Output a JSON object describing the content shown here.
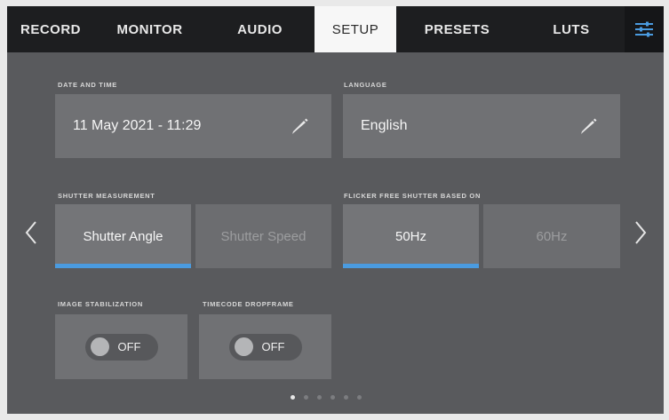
{
  "tabs": [
    {
      "label": "RECORD",
      "active": false
    },
    {
      "label": "MONITOR",
      "active": false
    },
    {
      "label": "AUDIO",
      "active": false
    },
    {
      "label": "SETUP",
      "active": true
    },
    {
      "label": "PRESETS",
      "active": false
    },
    {
      "label": "LUTS",
      "active": false
    }
  ],
  "settings_icon": "sliders-icon",
  "date_time": {
    "label": "DATE AND TIME",
    "value": "11 May 2021 - 11:29",
    "icon": "pencil-icon"
  },
  "language": {
    "label": "LANGUAGE",
    "value": "English",
    "icon": "pencil-icon"
  },
  "shutter_measurement": {
    "label": "SHUTTER MEASUREMENT",
    "options": [
      "Shutter Angle",
      "Shutter Speed"
    ],
    "selected": "Shutter Angle"
  },
  "flicker_free": {
    "label": "FLICKER FREE SHUTTER BASED ON",
    "options": [
      "50Hz",
      "60Hz"
    ],
    "selected": "50Hz"
  },
  "image_stabilization": {
    "label": "IMAGE STABILIZATION",
    "state": "OFF"
  },
  "timecode_dropframe": {
    "label": "TIMECODE DROPFRAME",
    "state": "OFF"
  },
  "pager": {
    "total": 6,
    "current": 1
  },
  "colors": {
    "accent": "#4a9be0",
    "background": "#595a5d",
    "tabbar": "#1d1e20"
  }
}
